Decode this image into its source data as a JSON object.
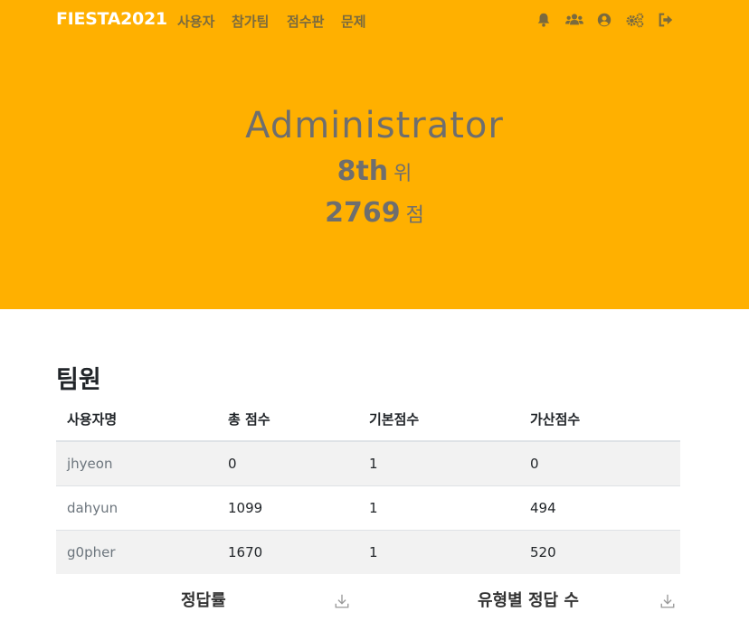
{
  "navbar": {
    "brand": "FIESTA2021",
    "links": [
      "사용자",
      "참가팀",
      "점수판",
      "문제"
    ],
    "icons": [
      "bell-icon",
      "users-icon",
      "user-circle-icon",
      "cogs-icon",
      "sign-out-icon"
    ]
  },
  "hero": {
    "name": "Administrator",
    "rank_value": "8th",
    "rank_unit": "위",
    "score_value": "2769",
    "score_unit": "점",
    "background": "#ffb000"
  },
  "members": {
    "title": "팀원",
    "headers": [
      "사용자명",
      "총 점수",
      "기본점수",
      "가산점수"
    ],
    "rows": [
      [
        "jhyeon",
        "0",
        "1",
        "0"
      ],
      [
        "dahyun",
        "1099",
        "1",
        "494"
      ],
      [
        "g0pher",
        "1670",
        "1",
        "520"
      ]
    ]
  },
  "charts": {
    "solve_rate_title": "정답률",
    "category_solves_title": "유형별 정답 수"
  }
}
